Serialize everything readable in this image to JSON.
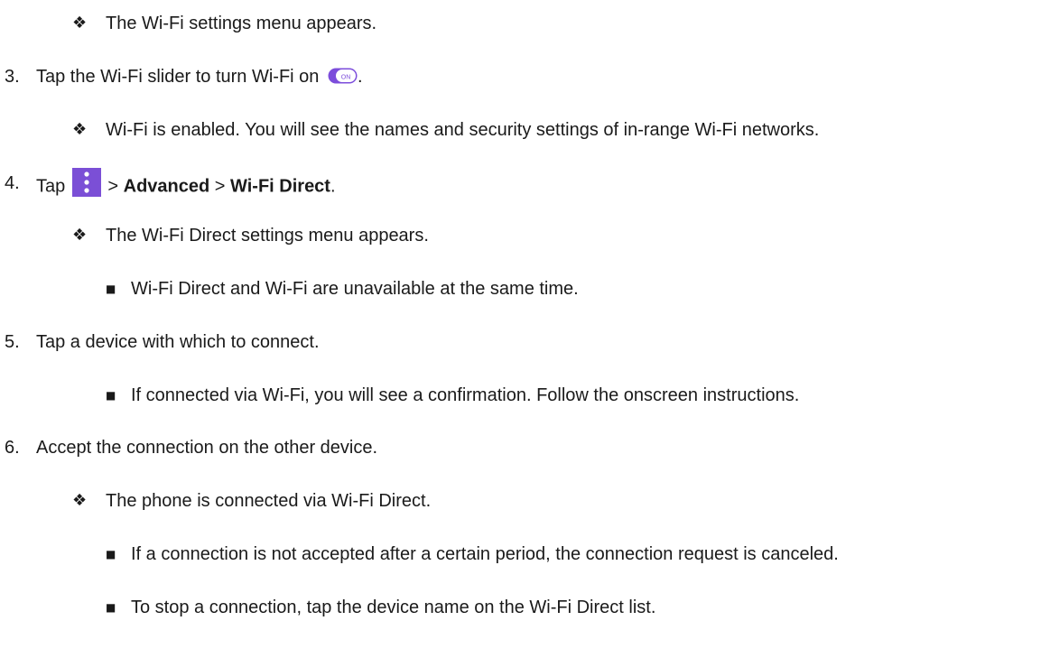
{
  "bullets": {
    "diamond": "❖",
    "square": "■"
  },
  "lines": {
    "l1": "The Wi-Fi settings menu appears.",
    "s3_num": "3.",
    "s3_text": "Tap the Wi-Fi slider to turn Wi-Fi on",
    "s3_end": ".",
    "l3": "Wi-Fi is enabled. You will see the names and security settings of in-range Wi-Fi networks.",
    "s4_num": "4.",
    "s4_tap": "Tap",
    "s4_sep1": ">",
    "s4_advanced": "Advanced",
    "s4_sep2": ">",
    "s4_wifidirect": "Wi-Fi Direct",
    "s4_end": ".",
    "l5": "The Wi-Fi Direct settings menu appears.",
    "l6": "Wi-Fi Direct and Wi-Fi are unavailable at the same time.",
    "s5_num": "5.",
    "s5_text": "Tap a device with which to connect.",
    "l8": "If connected via Wi-Fi, you will see a confirmation. Follow the onscreen instructions.",
    "s6_num": "6.",
    "s6_text": "Accept the connection on the other device.",
    "l10": "The phone is connected via Wi-Fi Direct.",
    "l11": "If a connection is not accepted after a certain period, the connection request is canceled.",
    "l12": "To stop a connection, tap the device name on the Wi-Fi Direct list."
  },
  "icons": {
    "toggle": "toggle-on-icon",
    "toggle_text": "ON",
    "menu": "more-options-icon"
  },
  "colors": {
    "toggle_purple": "#7c4ddb",
    "menu_purple": "#7b4fd6",
    "text": "#1a1a1a"
  }
}
